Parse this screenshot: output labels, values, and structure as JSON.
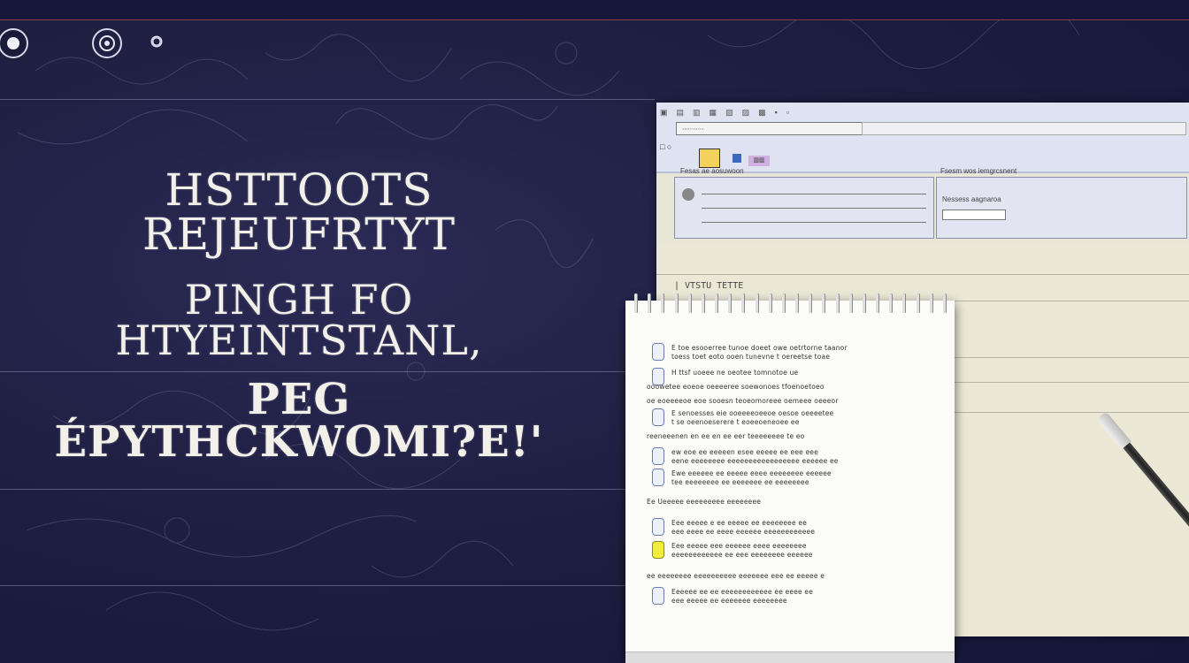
{
  "headline": {
    "line1": "HSTTOOTS REJEUFRTYT",
    "line2": "PINGH FO HTYEINTSTANL,",
    "line3": "PEG ÉPYTHCKWOMI?E!'"
  },
  "top_icons": [
    "circle-icon",
    "target-icon",
    "gear-icon"
  ],
  "window": {
    "field_text": "∙∙∙∙∙∙∙∙∙∙∙",
    "panel_a_label": "Fesas ae aosuwoon",
    "panel_b_label": "Fsesm wos iemgrcsnent",
    "panel_b_sub": "Nessess aagnaroa",
    "doc_header": "| VTSTU TETTE"
  },
  "notepad": {
    "items": [
      {
        "checkbox": "blue",
        "lines": [
          "E toe esooerree tunoe doeet owe oetrtorne taanor",
          "toess toet eoto ooen tunevne t oereetse toae"
        ]
      },
      {
        "checkbox": "blue",
        "lines": [
          "H ttsf uoeee ne oeotee tomnotoe ue"
        ]
      },
      {
        "checkbox": "none",
        "lines": [
          "ooowetee eoeoe oeeeeree soewonoes tfoenoetoeo"
        ]
      },
      {
        "checkbox": "none",
        "lines": [
          "oe eoeeeeoe eoe sooesn teoeomoreee oemeee oeeeor"
        ]
      },
      {
        "checkbox": "blue",
        "lines": [
          "E senoesses eie ooeeeeoeeoe oesoe oeeeetee",
          "t se oeenoeserere t eoeeoeneoee ee"
        ]
      },
      {
        "checkbox": "none",
        "lines": [
          "reeneeenen en ee en ee eer teeeeeeee te eo"
        ]
      },
      {
        "checkbox": "blue",
        "lines": [
          "ew eoe ee eeeeen esee eeeee ee eee eee",
          "eene eeeeeeee eeeeeeeeeeeeeeeee eeeeee ee"
        ]
      },
      {
        "checkbox": "blue",
        "lines": [
          "Ewe eeeeee ee eeeee eeee eeeeeeee eeeeee",
          "tee eeeeeeee ee eeeeeee ee eeeeeeee"
        ]
      },
      {
        "checkbox": "none",
        "lines": [
          "Ee Ueeeee eeeeeeeee eeeeeeee"
        ]
      },
      {
        "checkbox": "blue",
        "lines": [
          "Eee eeeee e ee eeeee ee eeeeeeee ee",
          "eee eeee ee eeee eeeeee eeeeeeeeeeee"
        ]
      },
      {
        "checkbox": "yellow",
        "lines": [
          "Eee eeeee eee eeeeee eeee eeeeeeee",
          "eeeeeeeeeeee ee eee eeeeeeee eeeeee"
        ]
      },
      {
        "checkbox": "none",
        "lines": [
          "ee eeeeeeee eeeeeeeeee eeeeeee eee ee eeeee e"
        ]
      },
      {
        "checkbox": "blue",
        "lines": [
          "Eeeeee ee ee eeeeeeeeeeee ee eeee ee",
          "eee eeeee ee eeeeeee eeeeeeee"
        ]
      }
    ]
  }
}
